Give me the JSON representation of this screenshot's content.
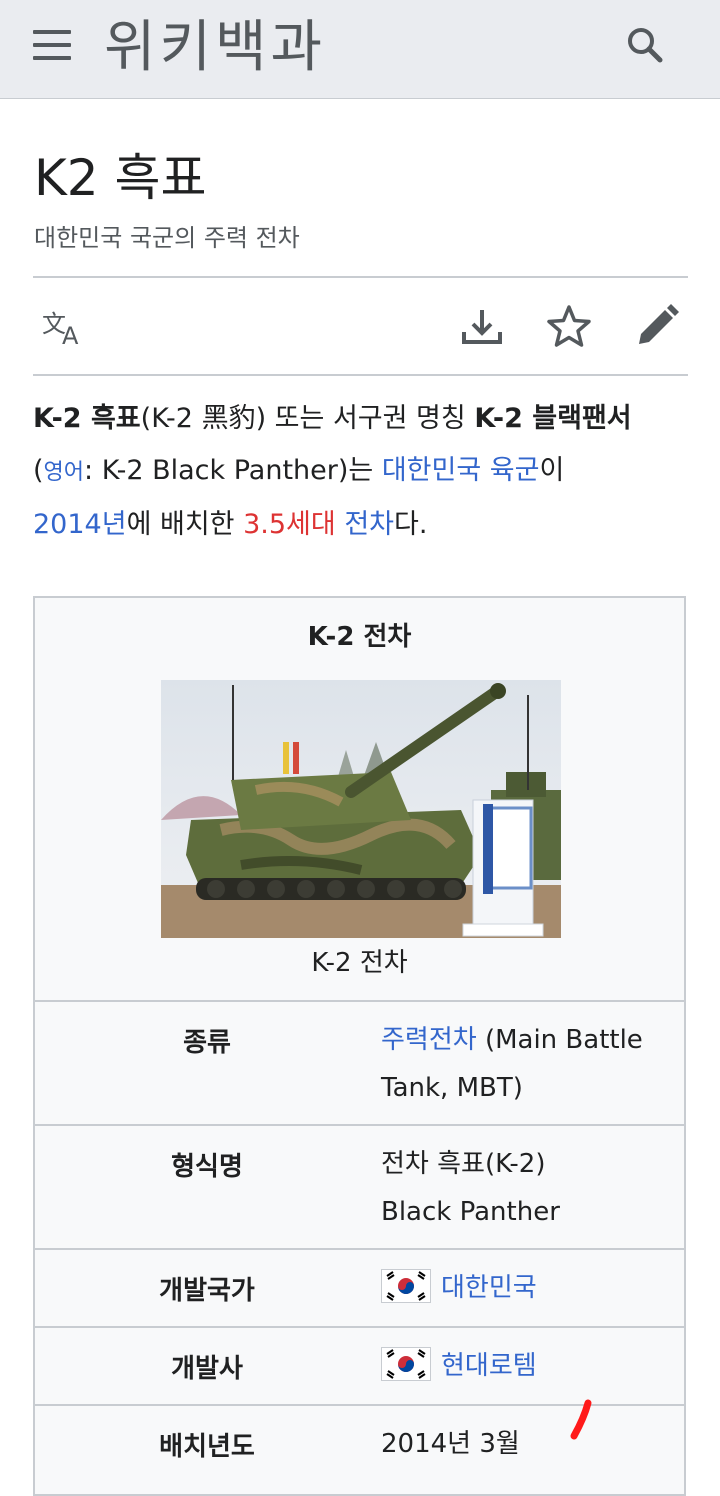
{
  "header": {
    "wordmark": "위키백과"
  },
  "page": {
    "title": "K2 흑표",
    "subtitle": "대한민국 국군의 주력 전차"
  },
  "intro": {
    "t1_bold": "K-2 흑표",
    "t2": "(K-2 黑豹) 또는 서구권 명칭 ",
    "t3_bold": "K-2 블랙팬서",
    "t4": "(",
    "t5_link": "영어",
    "t6": ": K-2 Black Panther)는 ",
    "t7_link": "대한민국 육군",
    "t8": "이 ",
    "t9_link": "2014년",
    "t10": "에 배치한 ",
    "t11_redlink": "3.5세대",
    "t12": " ",
    "t13_link": "전차",
    "t14": "다."
  },
  "infobox": {
    "title": "K-2 전차",
    "caption": "K-2 전차",
    "rows": [
      {
        "label": "종류",
        "value_link": "주력전차",
        "value_text": " (Main Battle Tank, MBT)"
      },
      {
        "label": "형식명",
        "value_line1": "전차 흑표(K-2)",
        "value_line2": "Black Panther"
      },
      {
        "label": "개발국가",
        "value_link": "대한민국"
      },
      {
        "label": "개발사",
        "value_link": "현대로템"
      },
      {
        "label": "배치년도",
        "value_text": "2014년 3월"
      }
    ]
  },
  "colors": {
    "link": "#3366cc",
    "redlink": "#dd3333",
    "header_bg": "#eaecf0",
    "annotation": "#ff1a1a"
  }
}
